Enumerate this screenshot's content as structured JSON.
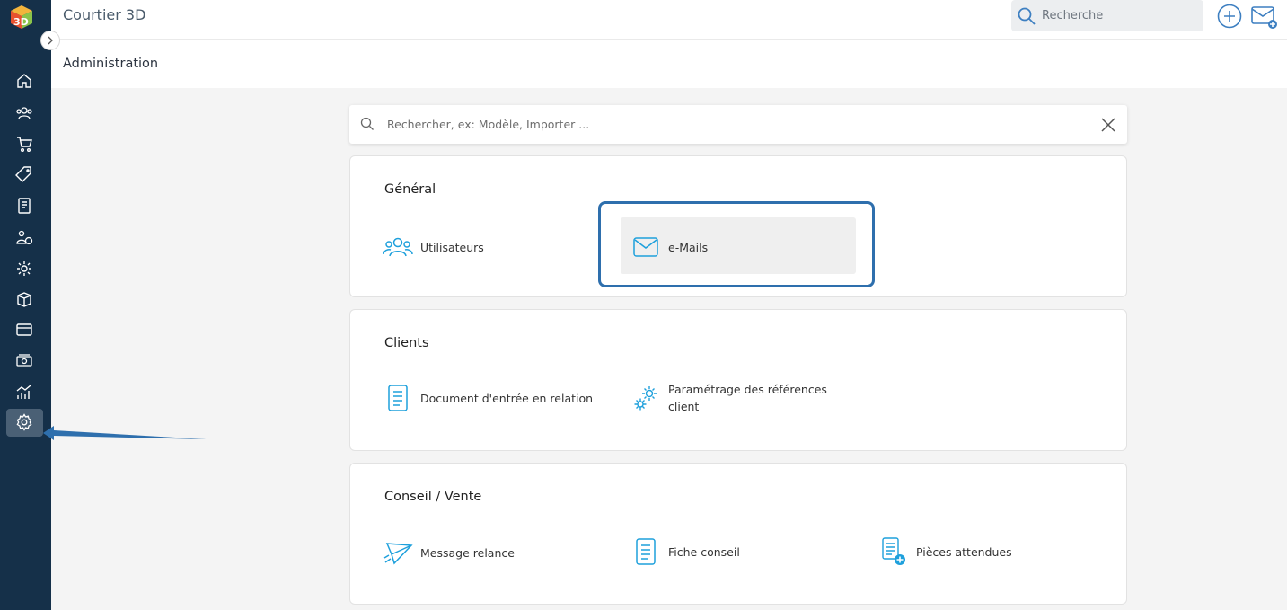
{
  "app": {
    "title": "Courtier 3D",
    "logo_text": "3D"
  },
  "header": {
    "search_placeholder": "Recherche"
  },
  "page": {
    "title": "Administration"
  },
  "admin_search": {
    "placeholder": "Rechercher, ex: Modèle, Importer ..."
  },
  "sections": {
    "general": {
      "title": "Général",
      "users_label": "Utilisateurs",
      "emails_label": "e-Mails"
    },
    "clients": {
      "title": "Clients",
      "document_label": "Document d'entrée en relation",
      "references_label": "Paramétrage des références client"
    },
    "conseil": {
      "title": "Conseil / Vente",
      "relance_label": "Message relance",
      "fiche_label": "Fiche conseil",
      "pieces_label": "Pièces attendues"
    }
  },
  "sidebar_icons": [
    "home-icon",
    "users-icon",
    "cart-icon",
    "tag-icon",
    "notebook-icon",
    "people-money-icon",
    "gear-badge-icon",
    "box-icon",
    "card-icon",
    "money-icon",
    "chart-icon",
    "settings-icon"
  ],
  "colors": {
    "sidebar": "#153049",
    "accent": "#1ea0dc",
    "highlight": "#2e6fad"
  }
}
